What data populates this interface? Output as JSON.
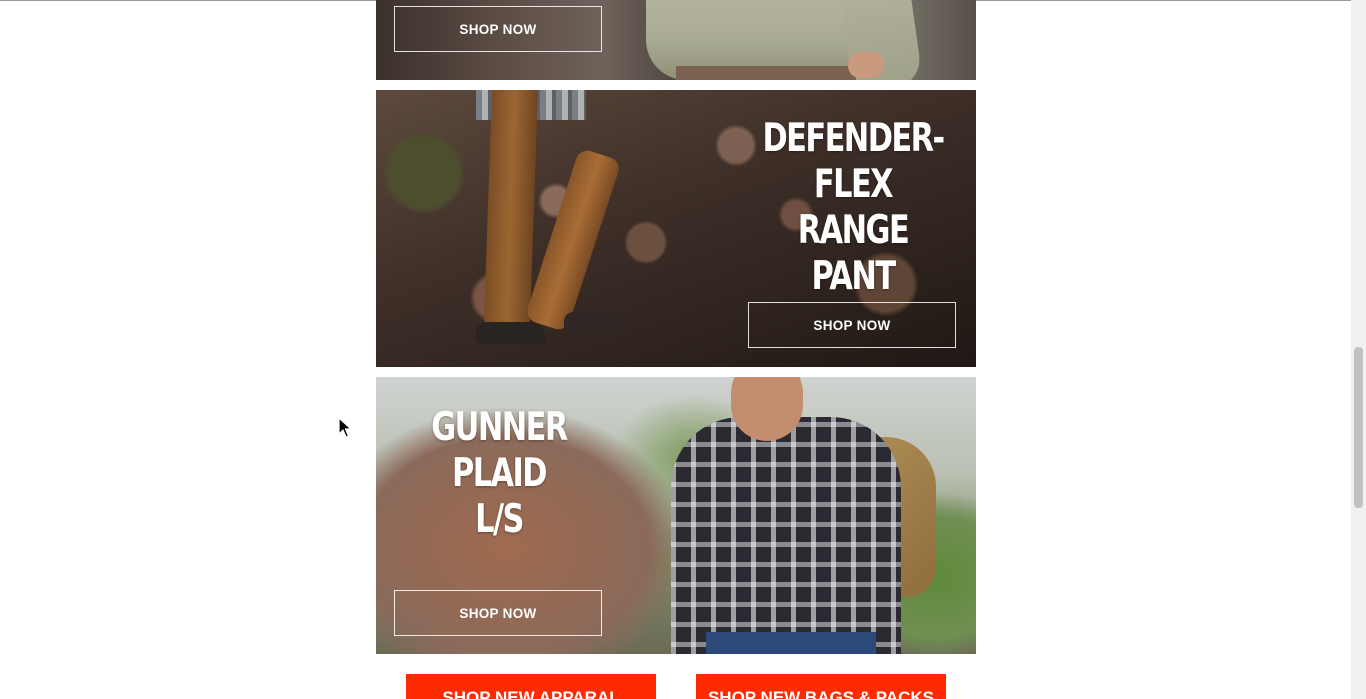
{
  "banners": [
    {
      "title": "",
      "button_label": "SHOP NOW"
    },
    {
      "title": "DEFENDER-FLEX\nRANGE\nPANT",
      "button_label": "SHOP NOW"
    },
    {
      "title": "GUNNER\nPLAID\nL/S",
      "button_label": "SHOP NOW"
    }
  ],
  "cta_buttons": {
    "apparel": "SHOP NEW APPARAL",
    "bags": "SHOP NEW BAGS & PACKS"
  },
  "colors": {
    "cta_background": "#ff2a00",
    "page_background": "#ffffff",
    "button_text": "#ffffff"
  },
  "icons": {
    "cursor": "mouse-pointer-icon"
  }
}
